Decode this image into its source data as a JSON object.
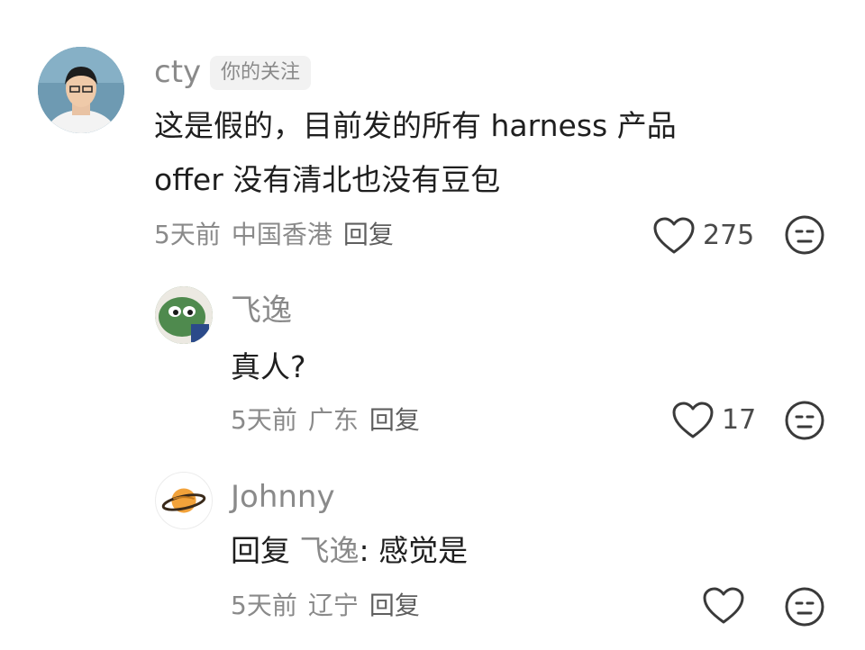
{
  "comments": [
    {
      "username": "cty",
      "badge": "你的关注",
      "text_line1": "这是假的，目前发的所有 harness 产品",
      "text_line2": "offer 没有清北也没有豆包",
      "time": "5天前",
      "location": "中国香港",
      "reply_label": "回复",
      "likes": "275"
    },
    {
      "username": "飞逸",
      "text": "真人?",
      "time": "5天前",
      "location": "广东",
      "reply_label": "回复",
      "likes": "17"
    },
    {
      "username": "Johnny",
      "reply_prefix": "回复",
      "reply_to": "飞逸",
      "reply_sep": ":",
      "text": "感觉是",
      "time": "5天前",
      "location": "辽宁",
      "reply_label": "回复",
      "likes": ""
    }
  ],
  "icons": {
    "like": "heart-outline-icon",
    "dislike": "meh-face-icon"
  },
  "colors": {
    "primary_text": "#1f1f1f",
    "secondary_text": "#8a8a8a",
    "badge_bg": "#f2f2f2",
    "icon_stroke": "#3a3a3a"
  }
}
